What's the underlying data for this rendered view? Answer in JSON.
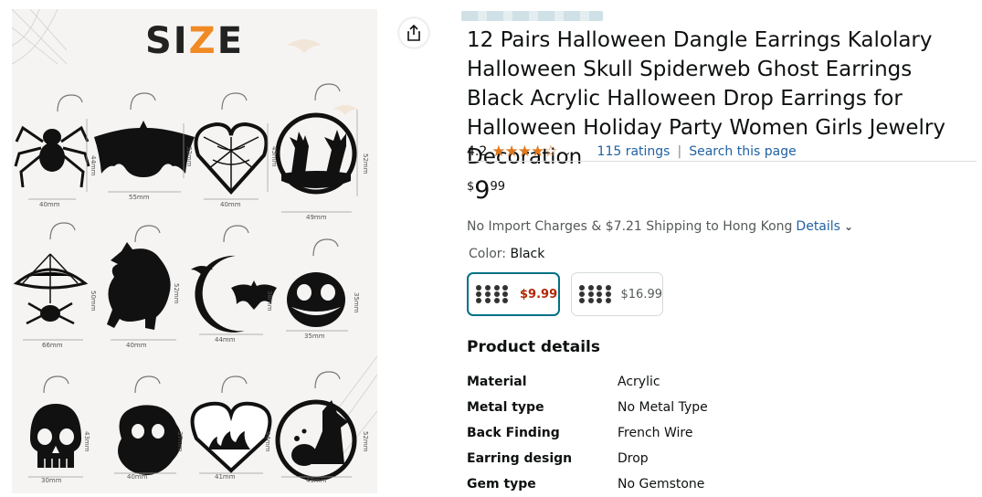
{
  "image": {
    "size_word": "SIZE",
    "dimensions": [
      "40mm",
      "55mm",
      "40mm",
      "49mm",
      "44mm",
      "32mm",
      "45mm",
      "52mm",
      "66mm",
      "40mm",
      "44mm",
      "35mm",
      "50mm",
      "52mm",
      "38mm",
      "35mm",
      "30mm",
      "40mm",
      "41mm",
      "49mm",
      "43mm",
      "37mm",
      "44mm",
      "52mm"
    ]
  },
  "product": {
    "title": "12 Pairs Halloween Dangle Earrings Kalolary Halloween Skull Spiderweb Ghost Earrings Black Acrylic Halloween Drop Earrings for Halloween Holiday Party Women Girls Jewelry Decoration",
    "rating_value": "4.2",
    "stars": "★★★★☆",
    "ratings_link": "115 ratings",
    "separator": "|",
    "search_link": "Search this page",
    "price_symbol": "$",
    "price_whole": "9",
    "price_fraction": "99",
    "shipping_text": "No Import Charges & $7.21 Shipping to Hong Kong",
    "shipping_details": "Details",
    "color_label": "Color:",
    "color_value": "Black",
    "swatches": [
      {
        "price": "$9.99",
        "selected": true
      },
      {
        "price": "$16.99",
        "selected": false
      }
    ]
  },
  "details": {
    "title": "Product details",
    "rows": [
      {
        "key": "Material",
        "value": "Acrylic"
      },
      {
        "key": "Metal type",
        "value": "No Metal Type"
      },
      {
        "key": "Back Finding",
        "value": "French Wire"
      },
      {
        "key": "Earring design",
        "value": "Drop"
      },
      {
        "key": "Gem type",
        "value": "No Gemstone"
      }
    ]
  },
  "colors": {
    "link": "#2162A1",
    "star": "#DE7921",
    "price_red": "#B12704",
    "selected_border": "#007185"
  }
}
